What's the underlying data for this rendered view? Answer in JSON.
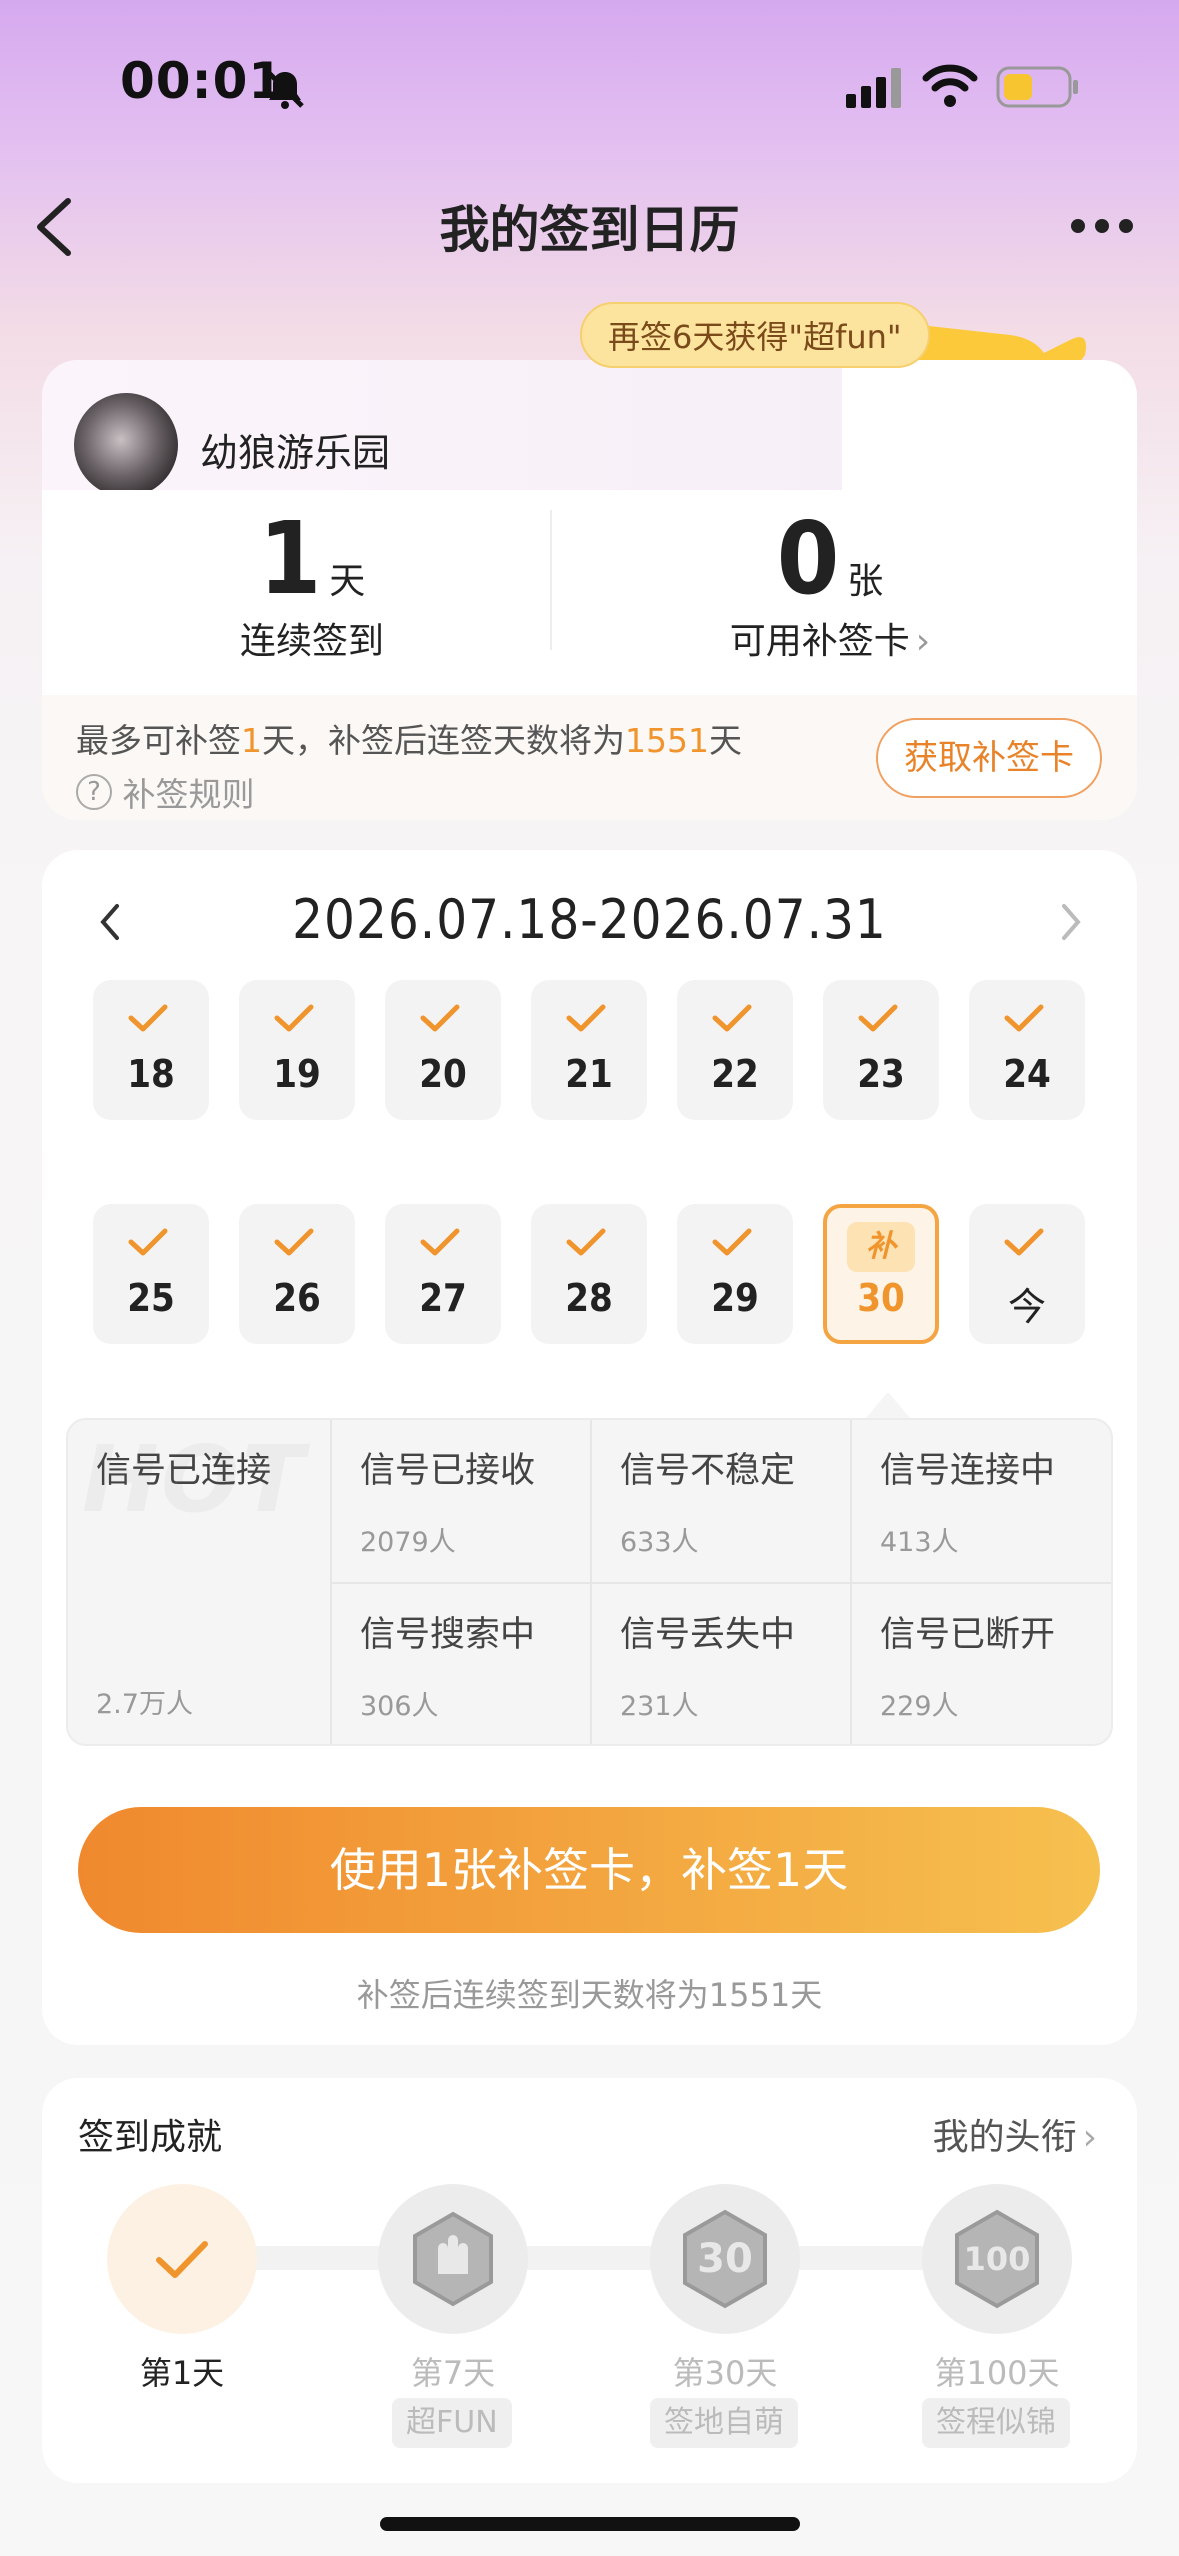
{
  "status_bar": {
    "time": "00:01"
  },
  "nav": {
    "title": "我的签到日历"
  },
  "promo": {
    "bubble": "再签6天获得\"超fun\""
  },
  "user": {
    "name": "幼狼游乐园"
  },
  "stats": {
    "streak_value": "1",
    "streak_unit": "天",
    "streak_label": "连续签到",
    "cards_value": "0",
    "cards_unit": "张",
    "cards_label": "可用补签卡"
  },
  "makeup": {
    "text_prefix": "最多可补签",
    "days": "1",
    "text_mid": "天，补签后连签天数将为",
    "total": "1551",
    "text_suffix": "天",
    "rules": "补签规则",
    "get_button": "获取补签卡"
  },
  "calendar": {
    "range": "2026.07.18-2026.07.31",
    "week1": [
      "18",
      "19",
      "20",
      "21",
      "22",
      "23",
      "24"
    ],
    "week2": [
      "25",
      "26",
      "27",
      "28",
      "29"
    ],
    "makeup_day": {
      "tag": "补",
      "day": "30"
    },
    "today": "今"
  },
  "options": [
    {
      "label": "信号已连接",
      "count": "2.7万人",
      "watermark": "HOT"
    },
    {
      "label": "信号已接收",
      "count": "2079人"
    },
    {
      "label": "信号不稳定",
      "count": "633人"
    },
    {
      "label": "信号连接中",
      "count": "413人"
    },
    {
      "label": "信号搜索中",
      "count": "306人"
    },
    {
      "label": "信号丢失中",
      "count": "231人"
    },
    {
      "label": "信号已断开",
      "count": "229人"
    }
  ],
  "action": {
    "button": "使用1张补签卡，补签1天",
    "hint": "补签后连续签到天数将为1551天"
  },
  "achievements": {
    "title": "签到成就",
    "link": "我的头衔",
    "items": [
      {
        "label": "第1天",
        "badge": ""
      },
      {
        "label": "第7天",
        "badge": "超FUN"
      },
      {
        "label": "第30天",
        "badge": "签地自萌"
      },
      {
        "label": "第100天",
        "badge": "签程似锦"
      }
    ]
  },
  "colors": {
    "accent": "#f0952d",
    "accent_text": "#e8832a",
    "button_start": "#f0892e",
    "button_end": "#f6c04f"
  }
}
